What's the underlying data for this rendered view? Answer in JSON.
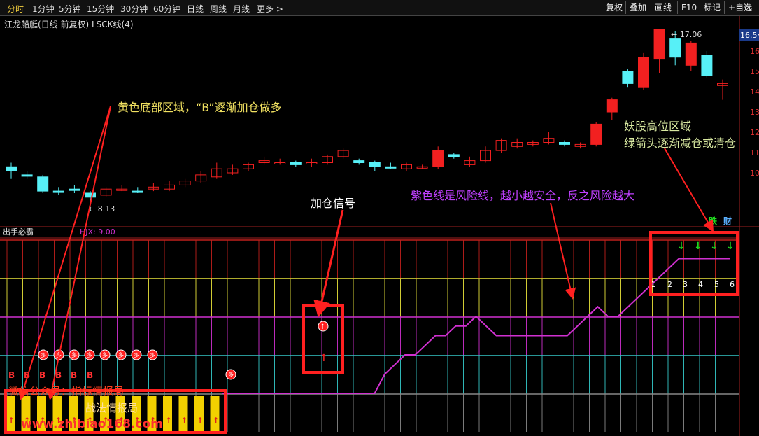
{
  "toolbar": {
    "periods": [
      "分时",
      "1分钟",
      "5分钟",
      "15分钟",
      "30分钟",
      "60分钟",
      "日线",
      "周线",
      "月线",
      "更多 >"
    ],
    "active_period": "分时",
    "tools": [
      "复权",
      "叠加",
      "画线",
      "F10",
      "标记",
      "+自选"
    ]
  },
  "chart_title": "江龙船艇(日线 前复权) LSCK线(4)",
  "main_chart": {
    "price_high_label": "← 17.06",
    "price_low_label": "← 8.13",
    "current_price_badge": "16.54",
    "axis_labels": [
      "16",
      "15",
      "14",
      "13",
      "12",
      "11",
      "10"
    ],
    "candles": [
      {
        "o": 10.3,
        "c": 10.1,
        "h": 10.5,
        "l": 9.7,
        "up": false
      },
      {
        "o": 9.9,
        "c": 9.9,
        "h": 10.1,
        "l": 9.7,
        "up": false
      },
      {
        "o": 9.8,
        "c": 9.1,
        "h": 9.9,
        "l": 9.0,
        "up": false
      },
      {
        "o": 9.1,
        "c": 9.1,
        "h": 9.3,
        "l": 8.9,
        "up": false
      },
      {
        "o": 9.2,
        "c": 9.2,
        "h": 9.4,
        "l": 9.0,
        "up": false
      },
      {
        "o": 9.0,
        "c": 8.8,
        "h": 9.1,
        "l": 8.13,
        "up": false
      },
      {
        "o": 8.9,
        "c": 9.2,
        "h": 9.3,
        "l": 8.8,
        "up": true
      },
      {
        "o": 9.2,
        "c": 9.2,
        "h": 9.4,
        "l": 9.1,
        "up": true
      },
      {
        "o": 9.1,
        "c": 9.1,
        "h": 9.3,
        "l": 9.0,
        "up": false
      },
      {
        "o": 9.2,
        "c": 9.3,
        "h": 9.5,
        "l": 9.1,
        "up": true
      },
      {
        "o": 9.2,
        "c": 9.4,
        "h": 9.6,
        "l": 9.1,
        "up": true
      },
      {
        "o": 9.4,
        "c": 9.6,
        "h": 9.7,
        "l": 9.3,
        "up": true
      },
      {
        "o": 9.6,
        "c": 9.9,
        "h": 10.1,
        "l": 9.5,
        "up": true
      },
      {
        "o": 9.8,
        "c": 10.2,
        "h": 10.5,
        "l": 9.7,
        "up": true
      },
      {
        "o": 10.0,
        "c": 10.2,
        "h": 10.4,
        "l": 9.9,
        "up": true
      },
      {
        "o": 10.2,
        "c": 10.4,
        "h": 10.5,
        "l": 10.1,
        "up": true
      },
      {
        "o": 10.5,
        "c": 10.6,
        "h": 10.8,
        "l": 10.4,
        "up": true
      },
      {
        "o": 10.5,
        "c": 10.5,
        "h": 10.7,
        "l": 10.4,
        "up": true
      },
      {
        "o": 10.5,
        "c": 10.4,
        "h": 10.6,
        "l": 10.3,
        "up": false
      },
      {
        "o": 10.5,
        "c": 10.5,
        "h": 10.7,
        "l": 10.3,
        "up": true
      },
      {
        "o": 10.5,
        "c": 10.8,
        "h": 10.9,
        "l": 10.4,
        "up": true
      },
      {
        "o": 10.8,
        "c": 11.1,
        "h": 11.2,
        "l": 10.7,
        "up": true
      },
      {
        "o": 10.6,
        "c": 10.5,
        "h": 10.7,
        "l": 10.4,
        "up": false
      },
      {
        "o": 10.5,
        "c": 10.3,
        "h": 10.6,
        "l": 10.1,
        "up": false
      },
      {
        "o": 10.3,
        "c": 10.3,
        "h": 10.5,
        "l": 10.2,
        "up": false
      },
      {
        "o": 10.2,
        "c": 10.4,
        "h": 10.5,
        "l": 10.1,
        "up": true
      },
      {
        "o": 10.3,
        "c": 10.3,
        "h": 10.4,
        "l": 10.2,
        "up": true
      },
      {
        "o": 10.3,
        "c": 11.1,
        "h": 11.3,
        "l": 10.2,
        "up": true
      },
      {
        "o": 10.9,
        "c": 10.8,
        "h": 11.0,
        "l": 10.7,
        "up": false
      },
      {
        "o": 10.4,
        "c": 10.6,
        "h": 10.8,
        "l": 10.3,
        "up": true
      },
      {
        "o": 10.6,
        "c": 11.1,
        "h": 11.3,
        "l": 10.5,
        "up": true
      },
      {
        "o": 11.1,
        "c": 11.6,
        "h": 11.7,
        "l": 11.0,
        "up": true
      },
      {
        "o": 11.3,
        "c": 11.5,
        "h": 11.7,
        "l": 11.2,
        "up": true
      },
      {
        "o": 11.4,
        "c": 11.5,
        "h": 11.6,
        "l": 11.3,
        "up": true
      },
      {
        "o": 11.5,
        "c": 11.7,
        "h": 12.0,
        "l": 11.4,
        "up": true
      },
      {
        "o": 11.5,
        "c": 11.4,
        "h": 11.6,
        "l": 11.3,
        "up": false
      },
      {
        "o": 11.3,
        "c": 11.4,
        "h": 11.5,
        "l": 11.2,
        "up": true
      },
      {
        "o": 11.4,
        "c": 12.4,
        "h": 12.5,
        "l": 11.3,
        "up": true
      },
      {
        "o": 13.0,
        "c": 13.6,
        "h": 13.7,
        "l": 12.6,
        "up": true
      },
      {
        "o": 14.4,
        "c": 15.0,
        "h": 15.1,
        "l": 14.2,
        "up": false
      },
      {
        "o": 14.2,
        "c": 15.7,
        "h": 15.9,
        "l": 14.1,
        "up": true
      },
      {
        "o": 15.6,
        "c": 17.06,
        "h": 17.1,
        "l": 14.9,
        "up": true
      },
      {
        "o": 16.6,
        "c": 15.7,
        "h": 17.0,
        "l": 15.3,
        "up": false
      },
      {
        "o": 15.3,
        "c": 16.4,
        "h": 16.5,
        "l": 15.0,
        "up": true
      },
      {
        "o": 15.8,
        "c": 14.8,
        "h": 16.0,
        "l": 14.7,
        "up": false
      },
      {
        "o": 14.4,
        "c": 14.3,
        "h": 14.6,
        "l": 13.6,
        "up": true
      }
    ]
  },
  "indicator": {
    "name": "出手必霸",
    "value_label": "HJX: 9.00",
    "risk_line": [
      2,
      2,
      2,
      2,
      2,
      2,
      2,
      2,
      2,
      2,
      2,
      2,
      2,
      2,
      2,
      2,
      3,
      3.5,
      4,
      4,
      4.5,
      5,
      5,
      5.5,
      5.5,
      6,
      5.5,
      5,
      5,
      5,
      5,
      5,
      5,
      5,
      5,
      5.5,
      6,
      6.5,
      6,
      6,
      6.5,
      7,
      7.5,
      8,
      8.5,
      9,
      9,
      9,
      9,
      9,
      9
    ],
    "b_markers": [
      "B",
      "B",
      "B",
      "B",
      "B",
      "B"
    ],
    "duo_marker_label": "多",
    "sell_labels": [
      "1",
      "2",
      "3",
      "4",
      "5",
      "6"
    ],
    "tag_die": "跌",
    "tag_cai": "财"
  },
  "annotations": {
    "yellow_zone": "黄色底部区域，“B”逐渐加仓做多",
    "add_signal": "加仓信号",
    "purple_line": "紫色线是风险线，越小越安全，反之风险越大",
    "demon_line1": "妖股高位区域",
    "demon_line2": "绿箭头逐渐减仓或清仓"
  },
  "watermark": {
    "line1": "微信公众号：指标情报局",
    "line2": "战法情报局",
    "line3": "www.zhibiao168.com"
  },
  "colors": {
    "up": "#f22020",
    "down": "#57f0f7",
    "grid_red": "#c0201c",
    "grid_yellow": "#e8e23a",
    "grid_magenta": "#d030d0",
    "grid_cyan": "#35c9c9",
    "grid_gray": "#888888",
    "risk_line": "#d030d0",
    "annotation_yellow": "#f0e060",
    "annotation_magenta": "#c040ff",
    "annotation_green": "#d8e8a0",
    "box_red": "#ff2020"
  }
}
